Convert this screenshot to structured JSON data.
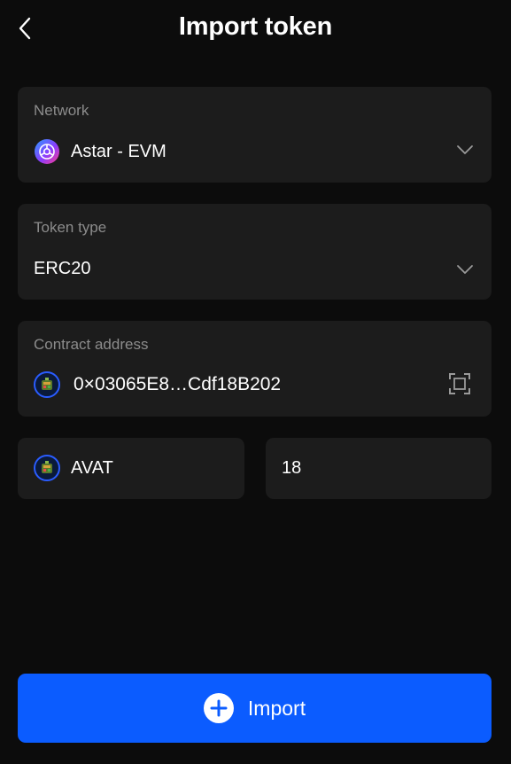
{
  "header": {
    "title": "Import token",
    "back_icon": "chevron-left-icon"
  },
  "network": {
    "label": "Network",
    "value": "Astar - EVM",
    "icon": "astar-network-icon"
  },
  "token_type": {
    "label": "Token type",
    "value": "ERC20"
  },
  "contract": {
    "label": "Contract address",
    "value": "0×03065E8…Cdf18B202",
    "scan_icon": "scan-qr-icon"
  },
  "symbol": {
    "value": "AVAT"
  },
  "decimals": {
    "value": "18"
  },
  "import_button": {
    "label": "Import",
    "icon": "plus-circle-icon"
  },
  "colors": {
    "background": "#0c0c0c",
    "card": "#1c1c1c",
    "label": "#8c8c8c",
    "accent": "#0b5cff"
  }
}
